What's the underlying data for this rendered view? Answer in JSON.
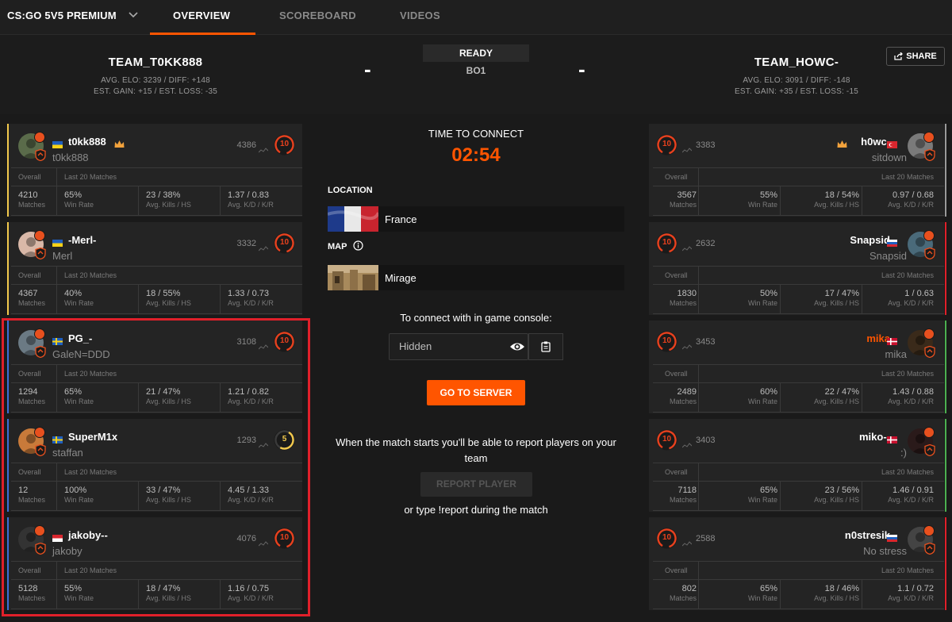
{
  "nav": {
    "title": "CS:GO 5V5 PREMIUM",
    "tabs": [
      "OVERVIEW",
      "SCOREBOARD",
      "VIDEOS"
    ]
  },
  "header": {
    "team1": {
      "name": "TEAM_T0KK888",
      "elo_line": "AVG. ELO: 3239 / DIFF: +148",
      "gain_line": "EST. GAIN: +15 / EST. LOSS: -35"
    },
    "team2": {
      "name": "TEAM_HOWC-",
      "elo_line": "AVG. ELO: 3091 / DIFF: -148",
      "gain_line": "EST. GAIN: +35 / EST. LOSS: -15"
    },
    "dash": "-",
    "status": "READY",
    "format": "BO1",
    "share_label": "SHARE"
  },
  "labels": {
    "overall": "Overall",
    "last20": "Last 20 Matches",
    "matches": "Matches",
    "win_rate": "Win Rate",
    "avg_kills": "Avg. Kills / HS",
    "avg_kd": "Avg. K/D / K/R"
  },
  "team1_players": [
    {
      "name": "t0kk888",
      "nick": "t0kk888",
      "elo": "4386",
      "level": "10",
      "matches": "4210",
      "win_rate": "65%",
      "kills_hs": "23 / 38%",
      "kd_kr": "1.37 / 0.83"
    },
    {
      "name": "-Merl-",
      "nick": "Merl",
      "elo": "3332",
      "level": "10",
      "matches": "4367",
      "win_rate": "40%",
      "kills_hs": "18 / 55%",
      "kd_kr": "1.33 / 0.73"
    },
    {
      "name": "PG_-",
      "nick": "GaleN=DDD",
      "elo": "3108",
      "level": "10",
      "matches": "1294",
      "win_rate": "65%",
      "kills_hs": "21 / 47%",
      "kd_kr": "1.21 / 0.82"
    },
    {
      "name": "SuperM1x",
      "nick": "staffan",
      "elo": "1293",
      "level": "5",
      "matches": "12",
      "win_rate": "100%",
      "kills_hs": "33 / 47%",
      "kd_kr": "4.45 / 1.33"
    },
    {
      "name": "jakoby--",
      "nick": "jakoby",
      "elo": "4076",
      "level": "10",
      "matches": "5128",
      "win_rate": "55%",
      "kills_hs": "18 / 47%",
      "kd_kr": "1.16 / 0.75"
    }
  ],
  "team2_players": [
    {
      "name": "h0wc-",
      "nick": "sitdown",
      "elo": "3383",
      "level": "10",
      "matches": "3567",
      "win_rate": "55%",
      "kills_hs": "18 / 54%",
      "kd_kr": "0.97 / 0.68"
    },
    {
      "name": "Snapsid",
      "nick": "Snapsid",
      "elo": "2632",
      "level": "10",
      "matches": "1830",
      "win_rate": "50%",
      "kills_hs": "17 / 47%",
      "kd_kr": "1 / 0.63"
    },
    {
      "name": "mika",
      "nick": "mika",
      "elo": "3453",
      "level": "10",
      "matches": "2489",
      "win_rate": "60%",
      "kills_hs": "22 / 47%",
      "kd_kr": "1.43 / 0.88"
    },
    {
      "name": "miko--",
      "nick": ":)",
      "elo": "3403",
      "level": "10",
      "matches": "7118",
      "win_rate": "65%",
      "kills_hs": "23 / 56%",
      "kd_kr": "1.46 / 0.91"
    },
    {
      "name": "n0stresik",
      "nick": "No stress",
      "elo": "2588",
      "level": "10",
      "matches": "802",
      "win_rate": "65%",
      "kills_hs": "18 / 46%",
      "kd_kr": "1.1 / 0.72"
    }
  ],
  "center": {
    "time_label": "TIME TO CONNECT",
    "timer": "02:54",
    "location_label": "LOCATION",
    "location": "France",
    "map_label": "MAP",
    "map": "Mirage",
    "console_label": "To connect with in game console:",
    "console_value": "Hidden",
    "go_button": "GO TO SERVER",
    "report_text": "When the match starts you'll be able to report players on your team",
    "report_button": "REPORT PLAYER",
    "type_text": "or type !report during the match"
  },
  "colors": {
    "accent": "#ff5500",
    "highlight": "#e0202a"
  }
}
